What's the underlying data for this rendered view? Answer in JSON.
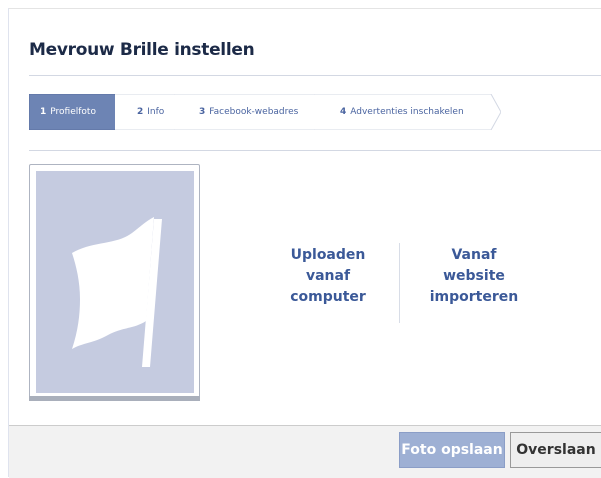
{
  "dialog": {
    "title": "Mevrouw Brille instellen"
  },
  "steps": [
    {
      "number": "1",
      "label": "Profielfoto",
      "active": true
    },
    {
      "number": "2",
      "label": "Info",
      "active": false
    },
    {
      "number": "3",
      "label": "Facebook-webadres",
      "active": false
    },
    {
      "number": "4",
      "label": "Advertenties inschakelen",
      "active": false
    }
  ],
  "photo": {
    "icon": "flag-icon"
  },
  "actions": {
    "upload": [
      "Uploaden",
      "vanaf",
      "computer"
    ],
    "import": [
      "Vanaf",
      "website",
      "importeren"
    ]
  },
  "footer": {
    "save_label": "Foto opslaan",
    "skip_label": "Overslaan"
  },
  "colors": {
    "active_step_bg": "#6d84b4",
    "link": "#3b5998",
    "title": "#1c2a47",
    "photo_bg": "#c5cbe0",
    "save_button_bg": "#9eb0d4"
  }
}
